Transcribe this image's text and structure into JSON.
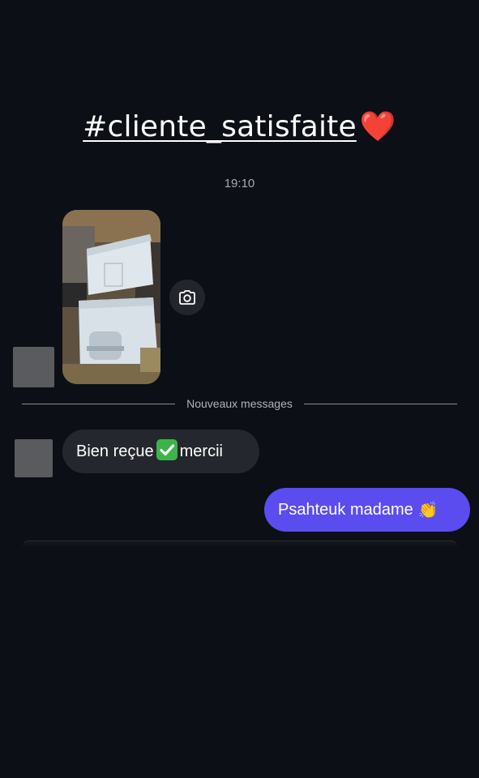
{
  "caption": {
    "hashtag": "#cliente_satisfaite",
    "emoji": "❤️"
  },
  "thread": {
    "timestamp": "19:10",
    "new_messages_label": "Nouveaux messages"
  },
  "messages": [
    {
      "type": "photo",
      "sender": "contact",
      "description_icon": "camera-icon"
    },
    {
      "type": "text",
      "sender": "contact",
      "text_before": "Bien reçue",
      "emoji": "✅",
      "text_after": "mercii"
    },
    {
      "type": "text",
      "sender": "me",
      "text": "Psahteuk madame",
      "emoji": "👏"
    }
  ],
  "colors": {
    "background": "#0d0f17",
    "incoming_bubble": "#25272f",
    "outgoing_bubble": "#5b4cf0",
    "heart": "#e0202e",
    "check": "#3db34a"
  }
}
